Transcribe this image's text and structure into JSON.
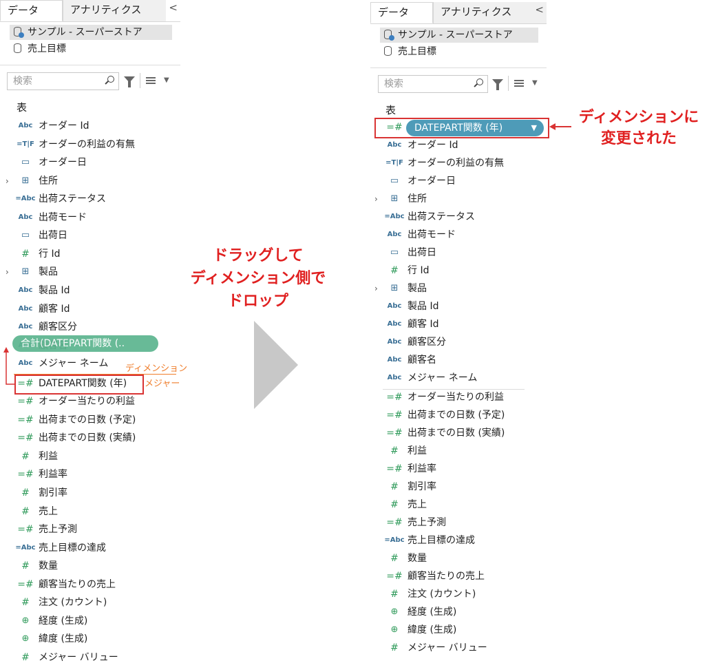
{
  "tabs": {
    "data": "データ",
    "analytics": "アナリティクス",
    "collapse": "<"
  },
  "datasources": [
    "サンプル - スーパーストア",
    "売上目標"
  ],
  "search": {
    "placeholder": "検索"
  },
  "section_label": "表",
  "left_fields": [
    {
      "icon": "Abc",
      "label": "オーダー Id"
    },
    {
      "icon": "=T|F",
      "label": "オーダーの利益の有無"
    },
    {
      "icon": "calendar-icon",
      "label": "オーダー日"
    },
    {
      "icon": "hierarchy-icon",
      "label": "住所",
      "expandable": true
    },
    {
      "icon": "=Abc",
      "label": "出荷ステータス"
    },
    {
      "icon": "Abc",
      "label": "出荷モード"
    },
    {
      "icon": "calendar-icon",
      "label": "出荷日"
    },
    {
      "icon": "#",
      "label": "行 Id"
    },
    {
      "icon": "hierarchy-icon",
      "label": "製品",
      "expandable": true
    },
    {
      "icon": "Abc",
      "label": "製品 Id"
    },
    {
      "icon": "Abc",
      "label": "顧客 Id"
    },
    {
      "icon": "Abc",
      "label": "顧客区分"
    },
    {
      "icon": "Abc",
      "label": "顧客名"
    },
    {
      "icon": "Abc",
      "label": "メジャー ネーム"
    },
    {
      "icon": "=#",
      "label": "DATEPART関数 (年)"
    },
    {
      "icon": "=#",
      "label": "オーダー当たりの利益"
    },
    {
      "icon": "=#",
      "label": "出荷までの日数 (予定)"
    },
    {
      "icon": "=#",
      "label": "出荷までの日数 (実績)"
    },
    {
      "icon": "#",
      "label": "利益"
    },
    {
      "icon": "=#",
      "label": "利益率"
    },
    {
      "icon": "#",
      "label": "割引率"
    },
    {
      "icon": "#",
      "label": "売上"
    },
    {
      "icon": "=#",
      "label": "売上予測"
    },
    {
      "icon": "=Abc",
      "label": "売上目標の達成"
    },
    {
      "icon": "#",
      "label": "数量"
    },
    {
      "icon": "=#",
      "label": "顧客当たりの売上"
    },
    {
      "icon": "#",
      "label": "注文 (カウント)"
    },
    {
      "icon": "globe-icon",
      "label": "経度 (生成)"
    },
    {
      "icon": "globe-icon",
      "label": "緯度 (生成)"
    },
    {
      "icon": "#",
      "label": "メジャー バリュー"
    }
  ],
  "right_fields": [
    {
      "icon": "=#",
      "label": "DATEPART関数 (年)",
      "pill": true
    },
    {
      "icon": "Abc",
      "label": "オーダー Id"
    },
    {
      "icon": "=T|F",
      "label": "オーダーの利益の有無"
    },
    {
      "icon": "calendar-icon",
      "label": "オーダー日"
    },
    {
      "icon": "hierarchy-icon",
      "label": "住所",
      "expandable": true
    },
    {
      "icon": "=Abc",
      "label": "出荷ステータス"
    },
    {
      "icon": "Abc",
      "label": "出荷モード"
    },
    {
      "icon": "calendar-icon",
      "label": "出荷日"
    },
    {
      "icon": "#",
      "label": "行 Id"
    },
    {
      "icon": "hierarchy-icon",
      "label": "製品",
      "expandable": true
    },
    {
      "icon": "Abc",
      "label": "製品 Id"
    },
    {
      "icon": "Abc",
      "label": "顧客 Id"
    },
    {
      "icon": "Abc",
      "label": "顧客区分"
    },
    {
      "icon": "Abc",
      "label": "顧客名"
    },
    {
      "icon": "Abc",
      "label": "メジャー ネーム"
    },
    {
      "icon": "=#",
      "label": "オーダー当たりの利益"
    },
    {
      "icon": "=#",
      "label": "出荷までの日数 (予定)"
    },
    {
      "icon": "=#",
      "label": "出荷までの日数 (実績)"
    },
    {
      "icon": "#",
      "label": "利益"
    },
    {
      "icon": "=#",
      "label": "利益率"
    },
    {
      "icon": "#",
      "label": "割引率"
    },
    {
      "icon": "#",
      "label": "売上"
    },
    {
      "icon": "=#",
      "label": "売上予測"
    },
    {
      "icon": "=Abc",
      "label": "売上目標の達成"
    },
    {
      "icon": "#",
      "label": "数量"
    },
    {
      "icon": "=#",
      "label": "顧客当たりの売上"
    },
    {
      "icon": "#",
      "label": "注文 (カウント)"
    },
    {
      "icon": "globe-icon",
      "label": "経度 (生成)"
    },
    {
      "icon": "globe-icon",
      "label": "緯度 (生成)"
    },
    {
      "icon": "#",
      "label": "メジャー バリュー"
    }
  ],
  "drag_pill": "合計(DATEPART関数 (..",
  "divider_labels": {
    "dimension": "ディメンション",
    "measure": "メジャー"
  },
  "annotations": {
    "drag_instruction": [
      "ドラッグして",
      "ディメンション側で",
      "ドロップ"
    ],
    "changed_note": [
      "ディメンションに",
      "変更された"
    ]
  },
  "colors": {
    "dimension_icon": "#3a6f95",
    "measure_icon": "#2f9a5a",
    "annotation_red": "#e02020",
    "orange": "#ef7d2b"
  }
}
